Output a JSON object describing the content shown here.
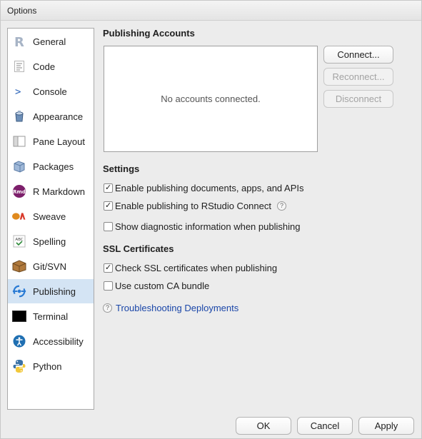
{
  "window": {
    "title": "Options"
  },
  "sidebar": {
    "items": [
      {
        "label": "General",
        "icon": "r-logo-icon"
      },
      {
        "label": "Code",
        "icon": "code-document-icon"
      },
      {
        "label": "Console",
        "icon": "console-prompt-icon"
      },
      {
        "label": "Appearance",
        "icon": "paint-bucket-icon"
      },
      {
        "label": "Pane Layout",
        "icon": "pane-layout-icon"
      },
      {
        "label": "Packages",
        "icon": "package-box-icon"
      },
      {
        "label": "R Markdown",
        "icon": "rmd-icon"
      },
      {
        "label": "Sweave",
        "icon": "sweave-icon"
      },
      {
        "label": "Spelling",
        "icon": "spelling-abc-icon"
      },
      {
        "label": "Git/SVN",
        "icon": "git-box-icon"
      },
      {
        "label": "Publishing",
        "icon": "publishing-icon",
        "selected": true
      },
      {
        "label": "Terminal",
        "icon": "terminal-icon"
      },
      {
        "label": "Accessibility",
        "icon": "accessibility-icon"
      },
      {
        "label": "Python",
        "icon": "python-icon"
      }
    ]
  },
  "publishing": {
    "accounts_title": "Publishing Accounts",
    "accounts_empty": "No accounts connected.",
    "connect": "Connect...",
    "reconnect": "Reconnect...",
    "disconnect": "Disconnect",
    "settings_title": "Settings",
    "enable_publishing": {
      "label": "Enable publishing documents, apps, and APIs",
      "checked": true
    },
    "enable_connect": {
      "label": "Enable publishing to RStudio Connect",
      "checked": true
    },
    "show_diagnostic": {
      "label": "Show diagnostic information when publishing",
      "checked": false
    },
    "ssl_title": "SSL Certificates",
    "check_ssl": {
      "label": "Check SSL certificates when publishing",
      "checked": true
    },
    "custom_ca": {
      "label": "Use custom CA bundle",
      "checked": false
    },
    "troubleshoot_link": "Troubleshooting Deployments"
  },
  "footer": {
    "ok": "OK",
    "cancel": "Cancel",
    "apply": "Apply"
  },
  "colors": {
    "selected_bg": "#d4e4f4",
    "link": "#1a46a8",
    "publishing_blue": "#2a7bd4"
  }
}
